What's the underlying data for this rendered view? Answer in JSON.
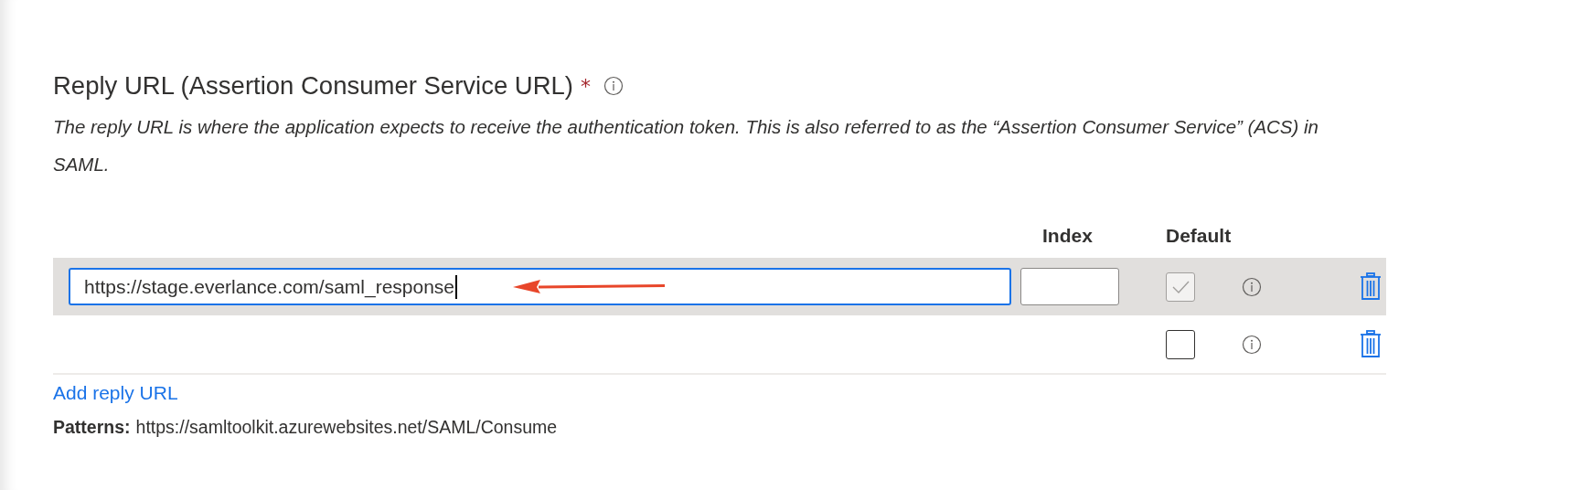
{
  "section": {
    "title": "Reply URL (Assertion Consumer Service URL)",
    "required_mark": "*",
    "description": "The reply URL is where the application expects to receive the authentication token. This is also referred to as the “Assertion Consumer Service” (ACS) in SAML."
  },
  "table": {
    "columns": [
      "Index",
      "Default"
    ],
    "rows": [
      {
        "kind": "edit",
        "selected": true,
        "url": "https://stage.everlance.com/saml_response",
        "default": {
          "checked": true,
          "disabled": true
        }
      },
      {
        "kind": "add",
        "selected": false,
        "default": {
          "checked": false,
          "disabled": false
        }
      }
    ]
  },
  "add_link": "Add reply URL",
  "patterns": {
    "label": "Patterns:",
    "value": "https://samltoolkit.azurewebsites.net/SAML/Consume"
  }
}
